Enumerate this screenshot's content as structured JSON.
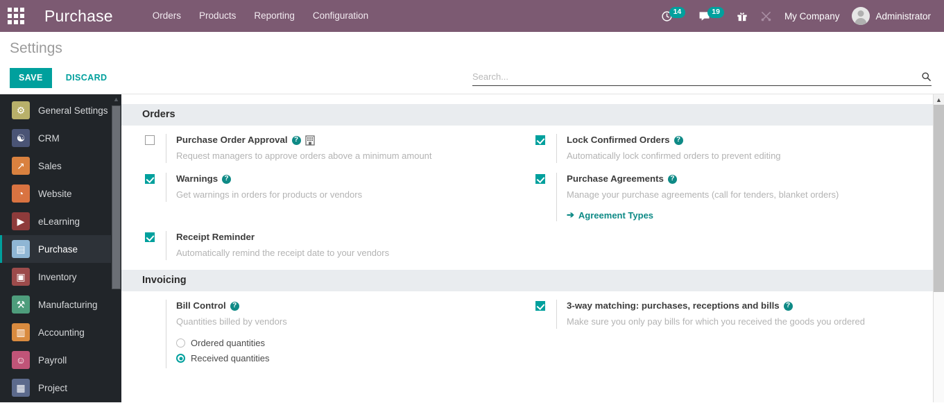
{
  "navbar": {
    "apps_icon": "apps-grid-icon",
    "brand": "Purchase",
    "menu": [
      {
        "label": "Orders",
        "name": "menu-orders"
      },
      {
        "label": "Products",
        "name": "menu-products"
      },
      {
        "label": "Reporting",
        "name": "menu-reporting"
      },
      {
        "label": "Configuration",
        "name": "menu-configuration"
      }
    ],
    "activities": {
      "icon": "clock-activity-icon",
      "badge": "14"
    },
    "messages": {
      "icon": "chat-bubble-icon",
      "badge": "19"
    },
    "gift": {
      "icon": "gift-icon"
    },
    "tools": {
      "icon": "crossed-tools-icon"
    },
    "company": "My Company",
    "user": "Administrator",
    "avatar_icon": "avatar-icon",
    "accent": "#7c5a72",
    "badge_color": "#00a09d"
  },
  "control_panel": {
    "title": "Settings",
    "save_label": "SAVE",
    "discard_label": "DISCARD",
    "search_placeholder": "Search...",
    "search_value": "",
    "search_icon": "search-icon"
  },
  "sidebar": {
    "items": [
      {
        "label": "General Settings",
        "icon": "gear-icon",
        "bg": "#b8b06a",
        "glyph": "⚙",
        "active": false
      },
      {
        "label": "CRM",
        "icon": "handshake-icon",
        "bg": "#4a5475",
        "glyph": "☯",
        "active": false
      },
      {
        "label": "Sales",
        "icon": "chart-up-icon",
        "bg": "#d9813f",
        "glyph": "↗",
        "active": false
      },
      {
        "label": "Website",
        "icon": "globe-icon",
        "bg": "#d97341",
        "glyph": "◔",
        "active": false
      },
      {
        "label": "eLearning",
        "icon": "graduation-icon",
        "bg": "#8e3b3b",
        "glyph": "▶",
        "active": false
      },
      {
        "label": "Purchase",
        "icon": "credit-card-icon",
        "bg": "#8fb6d4",
        "glyph": "▤",
        "active": true
      },
      {
        "label": "Inventory",
        "icon": "box-icon",
        "bg": "#9c4b4b",
        "glyph": "▣",
        "active": false
      },
      {
        "label": "Manufacturing",
        "icon": "wrench-icon",
        "bg": "#4e9d7c",
        "glyph": "⚒",
        "active": false
      },
      {
        "label": "Accounting",
        "icon": "invoice-icon",
        "bg": "#d98b3f",
        "glyph": "▥",
        "active": false
      },
      {
        "label": "Payroll",
        "icon": "person-badge-icon",
        "bg": "#c05478",
        "glyph": "☺",
        "active": false
      },
      {
        "label": "Project",
        "icon": "puzzle-icon",
        "bg": "#5c6a8c",
        "glyph": "▦",
        "active": false
      }
    ],
    "scroll_up_icon": "chevron-up-icon"
  },
  "settings": {
    "sections": [
      {
        "title": "Orders",
        "name": "section-orders",
        "rows": [
          [
            {
              "name": "purchase-order-approval",
              "checked": false,
              "label": "Purchase Order Approval",
              "help_icon": "help-icon",
              "company_icon": "multi-company-icon",
              "desc": "Request managers to approve orders above a minimum amount"
            },
            {
              "name": "lock-confirmed-orders",
              "checked": true,
              "label": "Lock Confirmed Orders",
              "help_icon": "help-icon",
              "company_icon": null,
              "desc": "Automatically lock confirmed orders to prevent editing"
            }
          ],
          [
            {
              "name": "warnings",
              "checked": true,
              "label": "Warnings",
              "help_icon": "help-icon",
              "company_icon": null,
              "desc": "Get warnings in orders for products or vendors"
            },
            {
              "name": "purchase-agreements",
              "checked": true,
              "label": "Purchase Agreements",
              "help_icon": "help-icon",
              "company_icon": null,
              "desc": "Manage your purchase agreements (call for tenders, blanket orders)",
              "link": {
                "label": "Agreement Types",
                "icon": "arrow-right-icon",
                "name": "agreement-types-link"
              }
            }
          ],
          [
            {
              "name": "receipt-reminder",
              "checked": true,
              "label": "Receipt Reminder",
              "help_icon": null,
              "company_icon": null,
              "desc": "Automatically remind the receipt date to your vendors"
            },
            null
          ]
        ]
      },
      {
        "title": "Invoicing",
        "name": "section-invoicing",
        "rows": [
          [
            {
              "name": "bill-control",
              "checked": null,
              "label": "Bill Control",
              "help_icon": "help-icon",
              "company_icon": null,
              "desc": "Quantities billed by vendors",
              "radios": [
                {
                  "label": "Ordered quantities",
                  "selected": false,
                  "name": "radio-ordered-quantities"
                },
                {
                  "label": "Received quantities",
                  "selected": true,
                  "name": "radio-received-quantities"
                }
              ]
            },
            {
              "name": "three-way-matching",
              "checked": true,
              "label": "3-way matching: purchases, receptions and bills",
              "help_icon": "help-icon",
              "company_icon": null,
              "desc": "Make sure you only pay bills for which you received the goods you ordered"
            }
          ]
        ]
      }
    ]
  },
  "colors": {
    "brand_purple": "#7c5a72",
    "teal": "#00a09d",
    "section_bg": "#e9ecef",
    "sidebar_bg": "#212529"
  }
}
